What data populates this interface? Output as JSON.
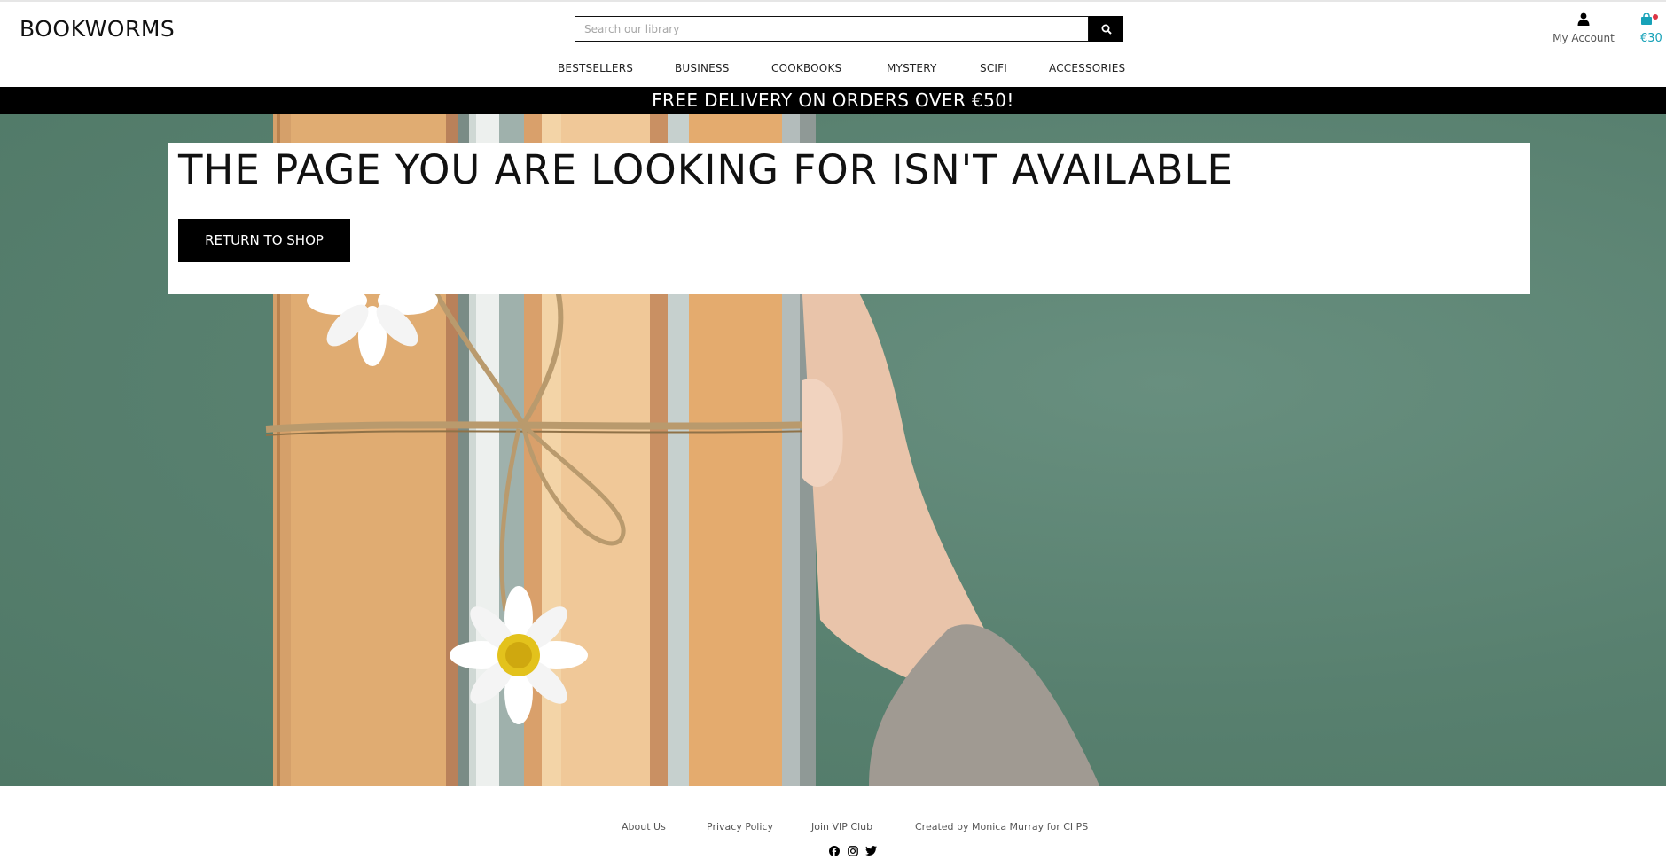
{
  "header": {
    "brand": "BOOKWORMS",
    "search": {
      "placeholder": "Search our library",
      "value": ""
    },
    "account_label": "My Account",
    "cart_total": "€30"
  },
  "nav": {
    "items": [
      "BESTSELLERS",
      "BUSINESS",
      "COOKBOOKS",
      "MYSTERY",
      "SCIFI",
      "ACCESSORIES"
    ]
  },
  "banner": {
    "text": "FREE DELIVERY ON ORDERS OVER €50!"
  },
  "main": {
    "heading": "THE PAGE YOU ARE LOOKING FOR ISN'T AVAILABLE",
    "return_label": "RETURN TO SHOP"
  },
  "footer": {
    "links": [
      "About Us",
      "Privacy Policy",
      "Join VIP Club",
      "Created by Monica Murray for CI PS"
    ],
    "social_icons": [
      "facebook-icon",
      "instagram-icon",
      "twitter-icon"
    ]
  },
  "colors": {
    "accent": "#17a2b8",
    "hero_bg": "#5b8674",
    "banner_bg": "#000000"
  }
}
